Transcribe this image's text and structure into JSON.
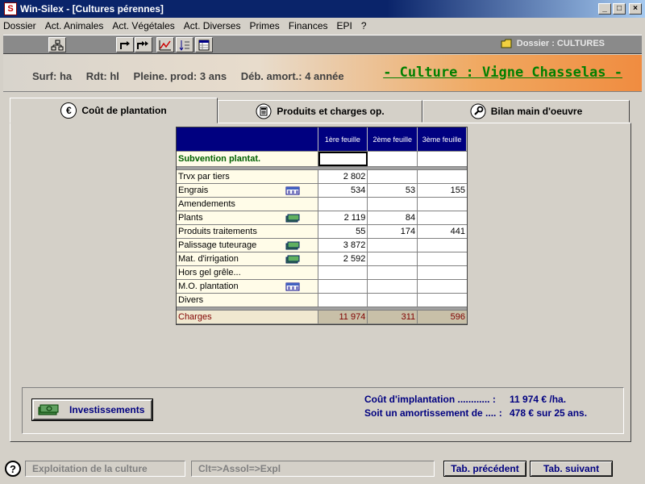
{
  "window": {
    "title": "Win-Silex - [Cultures pérennes]"
  },
  "menu": [
    "Dossier",
    "Act. Animales",
    "Act. Végétales",
    "Act. Diverses",
    "Primes",
    "Finances",
    "EPI",
    "?"
  ],
  "toolbar": {
    "dossier_label": "Dossier : CULTURES"
  },
  "header": {
    "surf": "Surf: ha",
    "rdt": "Rdt: hl",
    "pleine_prod": "Pleine. prod:  3 ans",
    "deb_amort": "Déb. amort.:  4 année",
    "culture": "- Culture : Vigne Chasselas -"
  },
  "tabs": [
    {
      "label": "Coût de plantation",
      "icon": "euro-icon"
    },
    {
      "label": "Produits et charges op.",
      "icon": "calculator-icon"
    },
    {
      "label": "Bilan main d'oeuvre",
      "icon": "wrench-icon"
    }
  ],
  "grid": {
    "columns": [
      "1ère feuille",
      "2ème feuille",
      "3ème feuille"
    ],
    "subvention_label": "Subvention plantat.",
    "rows": [
      {
        "label": "Trvx par tiers",
        "values": [
          "2 802",
          "",
          ""
        ],
        "icon": ""
      },
      {
        "label": "Engrais",
        "values": [
          "534",
          "53",
          "155"
        ],
        "icon": "calculator"
      },
      {
        "label": "Amendements",
        "values": [
          "",
          "",
          ""
        ],
        "icon": ""
      },
      {
        "label": "Plants",
        "values": [
          "2 119",
          "84",
          ""
        ],
        "icon": "money"
      },
      {
        "label": "Produits traitements",
        "values": [
          "55",
          "174",
          "441"
        ],
        "icon": ""
      },
      {
        "label": "Palissage tuteurage",
        "values": [
          "3 872",
          "",
          ""
        ],
        "icon": "money"
      },
      {
        "label": "Mat. d'irrigation",
        "values": [
          "2 592",
          "",
          ""
        ],
        "icon": "money"
      },
      {
        "label": "Hors gel grêle...",
        "values": [
          "",
          "",
          ""
        ],
        "icon": ""
      },
      {
        "label": "M.O. plantation",
        "values": [
          "",
          "",
          ""
        ],
        "icon": "calculator"
      },
      {
        "label": "Divers",
        "values": [
          "",
          "",
          ""
        ],
        "icon": ""
      }
    ],
    "charges": {
      "label": "Charges",
      "values": [
        "11 974",
        "311",
        "596"
      ]
    }
  },
  "investments": {
    "button_label": "Investissements",
    "cost_label": "Coût d'implantation ............ :",
    "cost_value": "11 974 € /ha.",
    "amort_label": "Soit un amortissement de .... :",
    "amort_value": "478 € sur  25 ans."
  },
  "status": {
    "field1": "Exploitation de la culture",
    "field2": "Clt=>Assol=>Expl",
    "prev_button": "Tab. précédent",
    "next_button": "Tab. suivant"
  }
}
